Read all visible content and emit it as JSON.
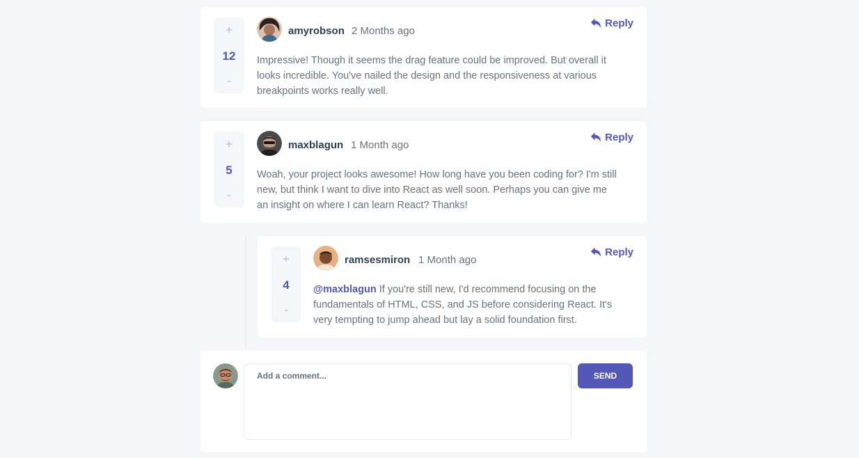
{
  "comments": [
    {
      "score": "12",
      "upvote": "+",
      "downvote": "-",
      "username": "amyrobson",
      "time": "2 Months ago",
      "reply_label": "Reply",
      "content": "Impressive! Though it seems the drag feature could be improved. But overall it looks incredible. You've nailed the design and the responsiveness at various breakpoints works really well."
    },
    {
      "score": "5",
      "upvote": "+",
      "downvote": "-",
      "username": "maxblagun",
      "time": "1 Month ago",
      "reply_label": "Reply",
      "content": "Woah, your project looks awesome! How long have you been coding for? I'm still new, but think I want to dive into React as well soon. Perhaps you can give me an insight on where I can learn React? Thanks!"
    }
  ],
  "reply": {
    "score": "4",
    "upvote": "+",
    "downvote": "-",
    "username": "ramsesmiron",
    "time": "1 Month ago",
    "reply_label": "Reply",
    "mention": "@maxblagun",
    "content": "If you're still new, I'd recommend focusing on the fundamentals of HTML, CSS, and JS before considering React. It's very tempting to jump ahead but lay a solid foundation first."
  },
  "composer": {
    "placeholder": "Add a comment...",
    "send_label": "SEND"
  },
  "colors": {
    "accent": "#5357b6",
    "vote_light": "#c5c6ef",
    "background": "#f5f6fa",
    "text_dark": "#324152",
    "text_muted": "#67727e"
  }
}
